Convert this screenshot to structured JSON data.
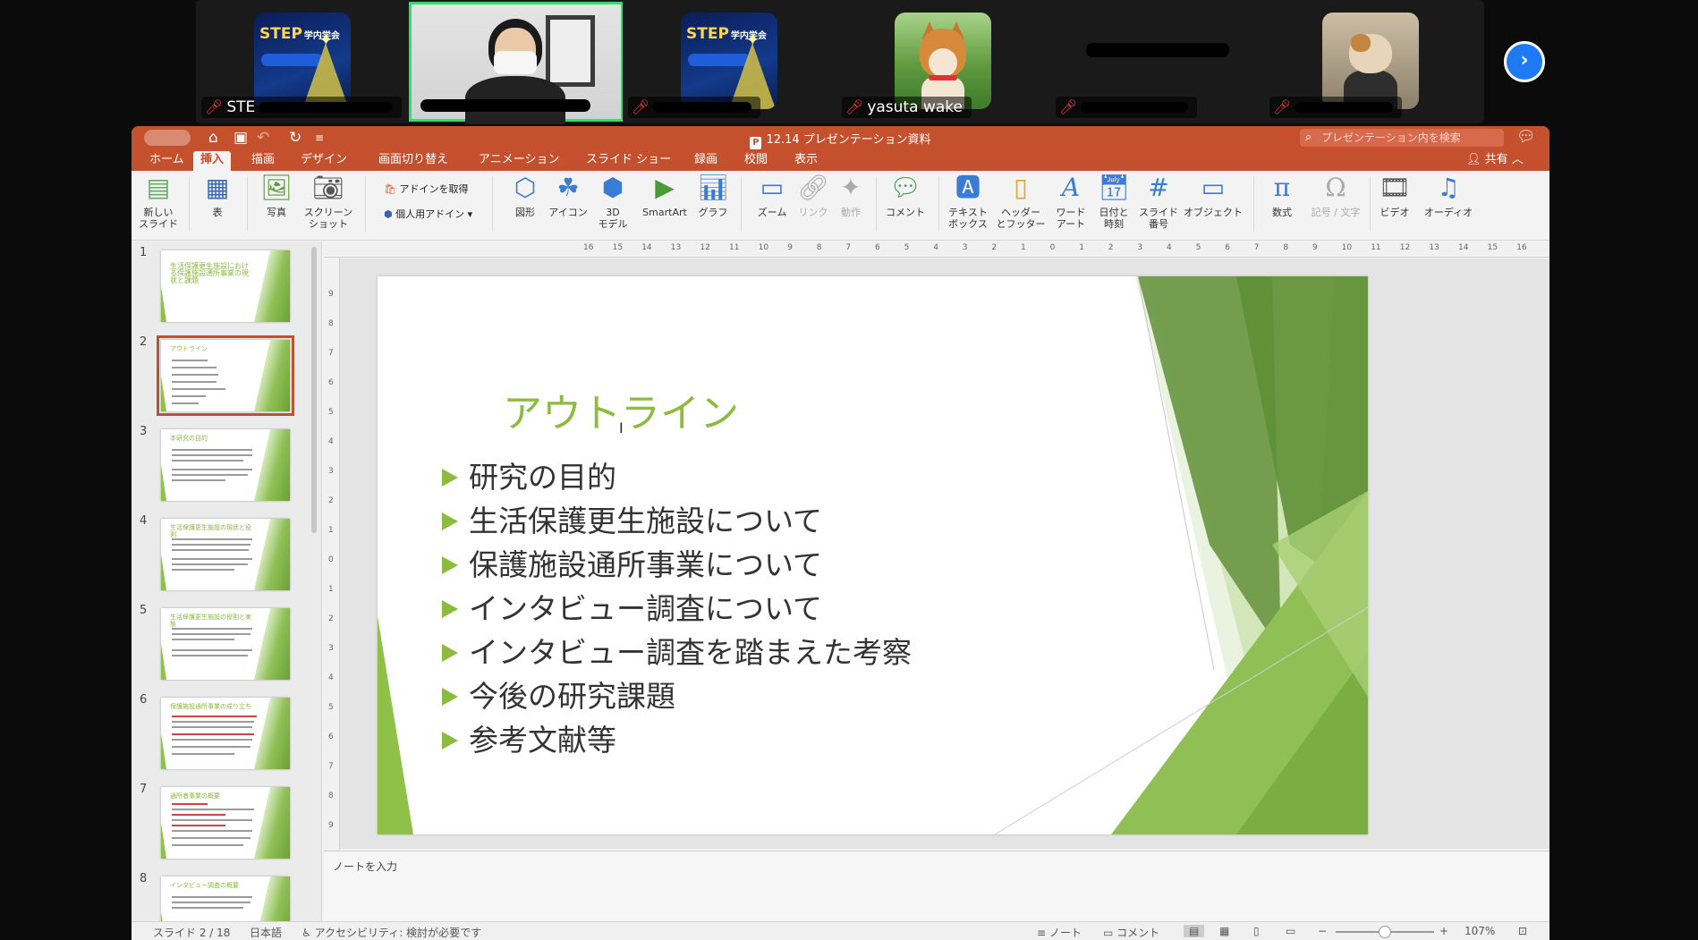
{
  "participants": [
    {
      "name": "STE",
      "muted": true,
      "thumb": "step-logo"
    },
    {
      "name": "",
      "muted": false,
      "thumb": "video-person",
      "active": true
    },
    {
      "name": "",
      "muted": true,
      "thumb": "step-logo"
    },
    {
      "name": "yasuta wake",
      "muted": true,
      "thumb": "shiba-dog-photo"
    },
    {
      "name": "",
      "muted": true,
      "thumb": "redacted"
    },
    {
      "name": "",
      "muted": true,
      "thumb": "cat-photo"
    }
  ],
  "step_logo_text": "STEP",
  "step_logo_sub": "学内学会",
  "window": {
    "title": "12.14 プレゼンテーション資料",
    "search_placeholder": "プレゼンテーション内を検索",
    "share_label": "共有"
  },
  "tabs": [
    "ホーム",
    "挿入",
    "描画",
    "デザイン",
    "画面切り替え",
    "アニメーション",
    "スライド ショー",
    "録画",
    "校閲",
    "表示"
  ],
  "selected_tab": "挿入",
  "ribbon": {
    "new_slide": "新しい\nスライド",
    "table": "表",
    "photo": "写真",
    "screenshot": "スクリーン\nショット",
    "get_addins": "アドインを取得",
    "my_addins": "個人用アドイン",
    "shapes": "図形",
    "icons": "アイコン",
    "model3d": "3D\nモデル",
    "smartart": "SmartArt",
    "chart": "グラフ",
    "zoom": "ズーム",
    "link": "リンク",
    "action": "動作",
    "comment": "コメント",
    "textbox": "テキスト\nボックス",
    "header_footer": "ヘッダー\nとフッター",
    "wordart": "ワード\nアート",
    "datetime": "日付と\n時刻",
    "slide_number": "スライド\n番号",
    "object": "オブジェクト",
    "equation": "数式",
    "symbol": "記号 / 文字",
    "video": "ビデオ",
    "audio": "オーディオ"
  },
  "thumbnails": [
    {
      "num": "1",
      "title": "生活保護更生施設における保護施設通所事業の現状と課題"
    },
    {
      "num": "2",
      "title": "アウトライン"
    },
    {
      "num": "3",
      "title": "本研究の目的"
    },
    {
      "num": "4",
      "title": "生活保護更生施設の現状と役割"
    },
    {
      "num": "5",
      "title": "生活保護更生施設の役割と実態"
    },
    {
      "num": "6",
      "title": "保護施設通所事業の成り立ち"
    },
    {
      "num": "7",
      "title": "通所者事業の概要"
    },
    {
      "num": "8",
      "title": "インタビュー調査の概要"
    }
  ],
  "selected_slide": 2,
  "slide": {
    "title": "アウトライン",
    "bullets": [
      "研究の目的",
      "生活保護更生施設について",
      "保護施設通所事業について",
      "インタビュー調査について",
      "インタビュー調査を踏まえた考察",
      "今後の研究課題",
      "参考文献等"
    ]
  },
  "ruler_h": [
    "16",
    "15",
    "14",
    "13",
    "12",
    "11",
    "10",
    "9",
    "8",
    "7",
    "6",
    "5",
    "4",
    "3",
    "2",
    "1",
    "0",
    "1",
    "2",
    "3",
    "4",
    "5",
    "6",
    "7",
    "8",
    "9",
    "10",
    "11",
    "12",
    "13",
    "14",
    "15",
    "16"
  ],
  "ruler_v": [
    "9",
    "8",
    "7",
    "6",
    "5",
    "4",
    "3",
    "2",
    "1",
    "0",
    "1",
    "2",
    "3",
    "4",
    "5",
    "6",
    "7",
    "8",
    "9"
  ],
  "notes_placeholder": "ノートを入力",
  "status": {
    "slide_pos": "スライド 2 / 18",
    "language": "日本語",
    "accessibility": "アクセシビリティ: 検討が必要です",
    "notes": "ノート",
    "comments": "コメント",
    "zoom": "107%"
  },
  "colors": {
    "ppt_accent": "#c4502e",
    "slide_green": "#8dbb3f",
    "active_speaker": "#2fe06a",
    "zoom_blue": "#1d7af2"
  }
}
